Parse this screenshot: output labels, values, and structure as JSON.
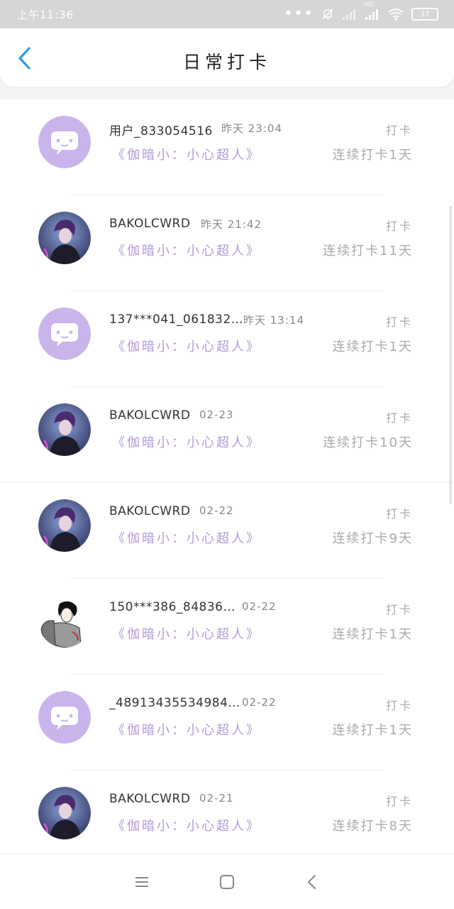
{
  "status_bar": {
    "time": "上午11:36",
    "signal_label": "HD",
    "battery": "37",
    "icons": [
      "more-dots-icon",
      "mute-bell-icon",
      "signal-icon",
      "signal-hd-icon",
      "wifi-icon",
      "battery-icon"
    ]
  },
  "header": {
    "title": "日常打卡",
    "back_icon": "chevron-left-icon",
    "accent_color": "#2f9bea"
  },
  "colors": {
    "book_title": "#b39ad9",
    "avatar_default_bg": "#c9b5ec"
  },
  "entries": [
    {
      "username": "用户_833054516",
      "time": "昨天 23:04",
      "action": "打卡",
      "book": "《伽暗小：小心超人》",
      "streak": "连续打卡1天",
      "avatar": "default-chat-avatar"
    },
    {
      "username": "BAKOLCWRD",
      "time": "昨天 21:42",
      "action": "打卡",
      "book": "《伽暗小：小心超人》",
      "streak": "连续打卡11天",
      "avatar": "anime-character-avatar"
    },
    {
      "username": "137***041_061832…",
      "time": "昨天 13:14",
      "action": "打卡",
      "book": "《伽暗小：小心超人》",
      "streak": "连续打卡1天",
      "avatar": "default-chat-avatar"
    },
    {
      "username": "BAKOLCWRD",
      "time": "02-23",
      "action": "打卡",
      "book": "《伽暗小：小心超人》",
      "streak": "连续打卡10天",
      "avatar": "anime-character-avatar"
    },
    {
      "username": "BAKOLCWRD",
      "time": "02-22",
      "action": "打卡",
      "book": "《伽暗小：小心超人》",
      "streak": "连续打卡9天",
      "avatar": "anime-character-avatar"
    },
    {
      "username": "150***386_84836…",
      "time": "02-22",
      "action": "打卡",
      "book": "《伽暗小：小心超人》",
      "streak": "连续打卡1天",
      "avatar": "sketch-person-avatar"
    },
    {
      "username": "_48913435534984…",
      "time": "02-22",
      "action": "打卡",
      "book": "《伽暗小：小心超人》",
      "streak": "连续打卡1天",
      "avatar": "default-chat-avatar"
    },
    {
      "username": "BAKOLCWRD",
      "time": "02-21",
      "action": "打卡",
      "book": "《伽暗小：小心超人》",
      "streak": "连续打卡8天",
      "avatar": "anime-character-avatar"
    }
  ],
  "nav_bar": {
    "icons": [
      "menu-icon",
      "home-square-icon",
      "back-triangle-icon"
    ]
  }
}
